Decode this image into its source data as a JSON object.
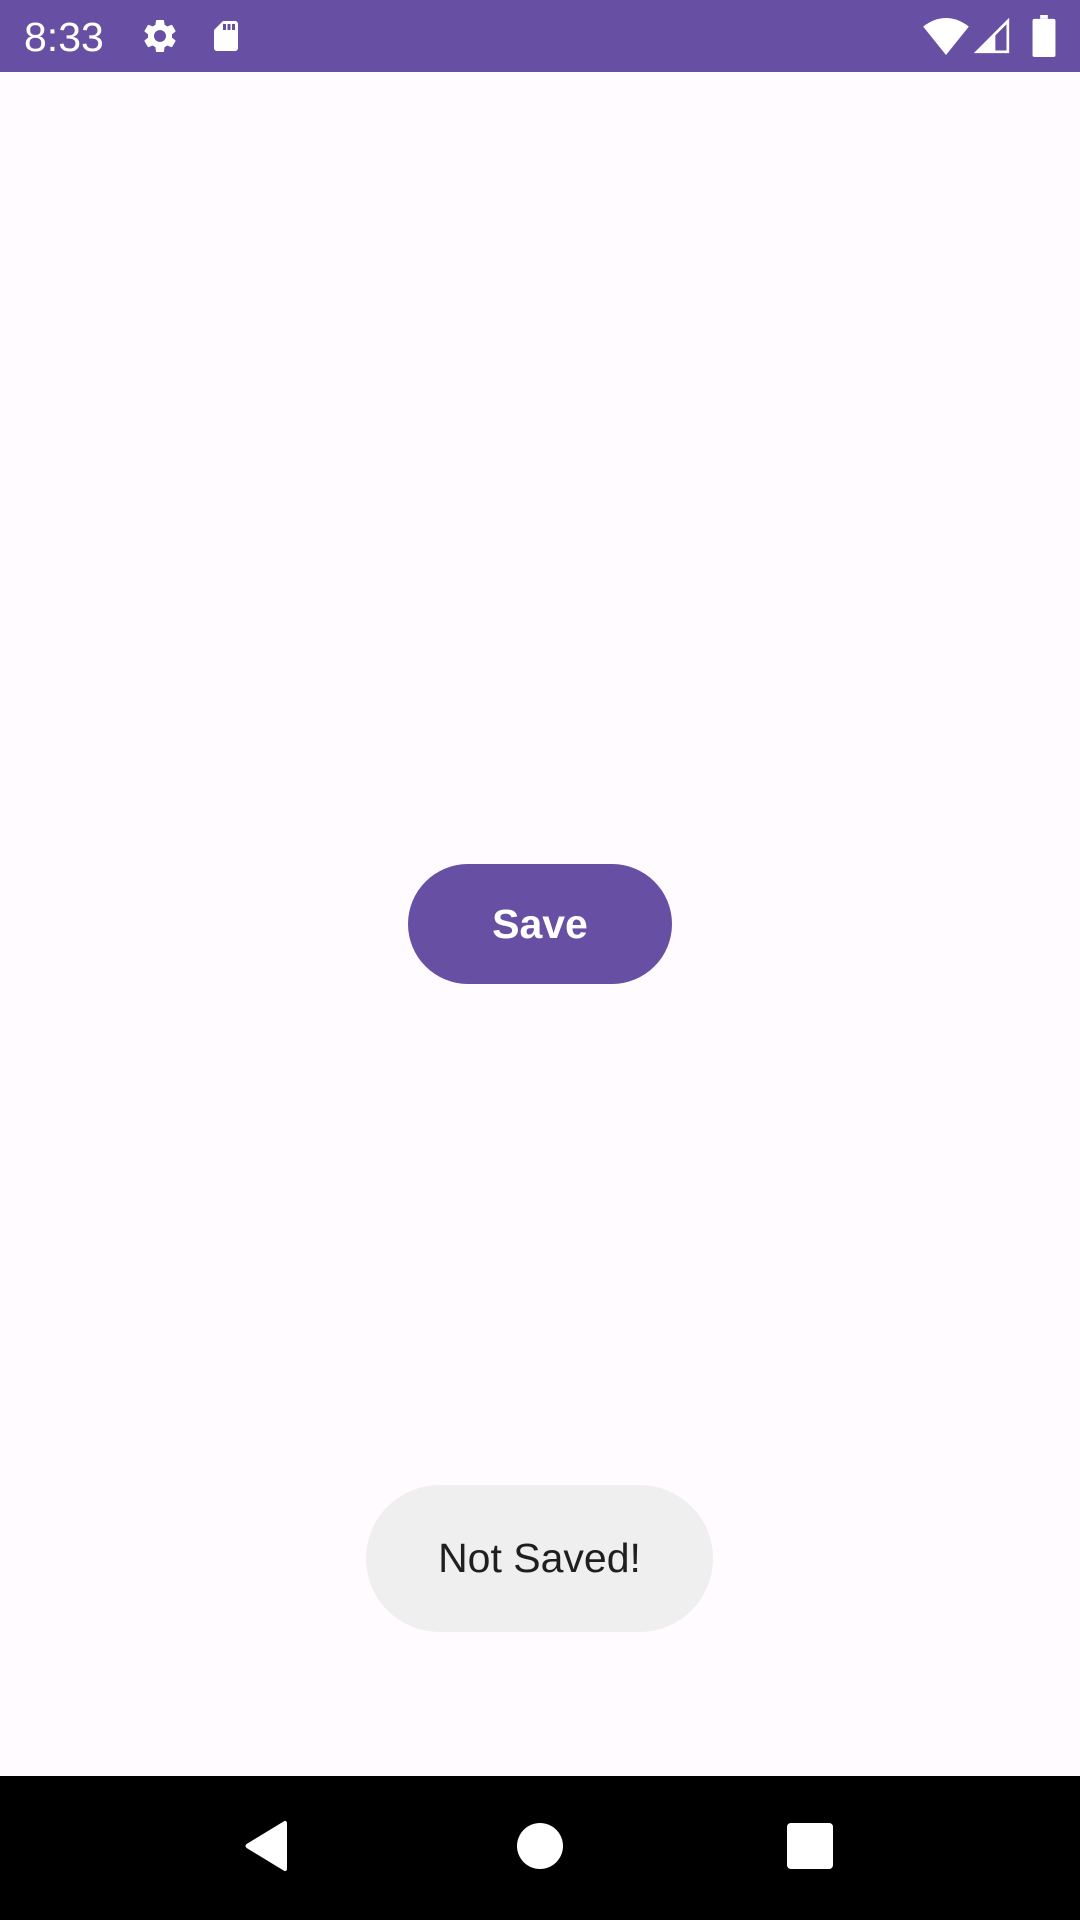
{
  "status_bar": {
    "time": "8:33",
    "background": "#6750a4",
    "left_icons": [
      "gear-icon",
      "sd-card-icon"
    ],
    "right_icons": [
      "wifi-icon",
      "cell-signal-icon",
      "battery-icon"
    ]
  },
  "main": {
    "save_button": {
      "label": "Save",
      "color": "#6750a4"
    }
  },
  "toast": {
    "message": "Not Saved!"
  },
  "nav_bar": {
    "buttons": [
      "back-icon",
      "home-icon",
      "recents-icon"
    ]
  }
}
